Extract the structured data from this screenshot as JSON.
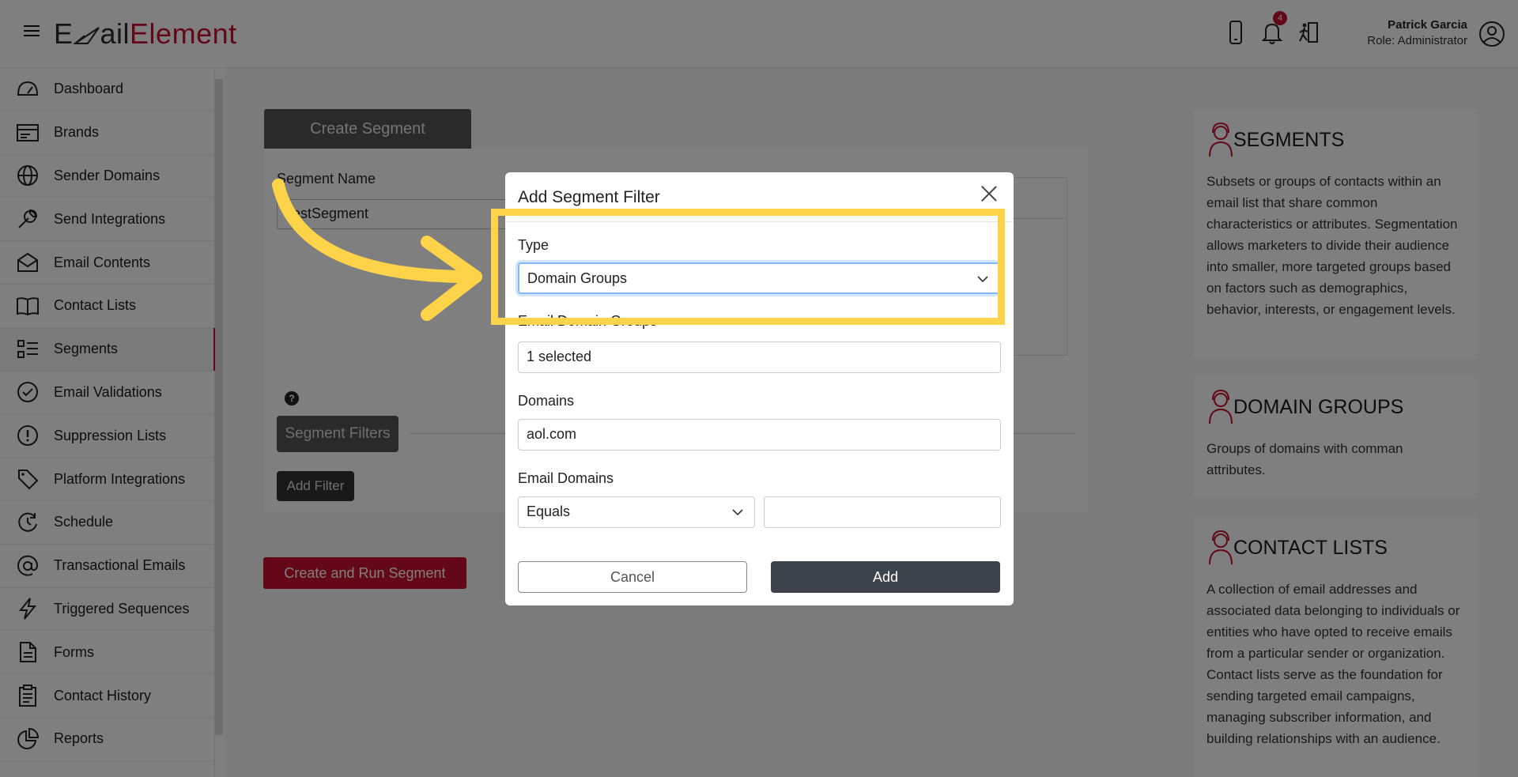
{
  "header": {
    "logo_part1": "E",
    "logo_part2": "ail",
    "logo_part3": "Element",
    "notification_count": "4",
    "user_name": "Patrick Garcia",
    "user_role": "Role: Administrator"
  },
  "sidebar": {
    "items": [
      {
        "label": "Dashboard",
        "icon": "dashboard-icon"
      },
      {
        "label": "Brands",
        "icon": "brands-icon"
      },
      {
        "label": "Sender Domains",
        "icon": "globe-icon"
      },
      {
        "label": "Send Integrations",
        "icon": "wrench-icon"
      },
      {
        "label": "Email Contents",
        "icon": "envelope-icon"
      },
      {
        "label": "Contact Lists",
        "icon": "book-icon"
      },
      {
        "label": "Segments",
        "icon": "segments-icon"
      },
      {
        "label": "Email Validations",
        "icon": "check-circle-icon"
      },
      {
        "label": "Suppression Lists",
        "icon": "exclamation-circle-icon"
      },
      {
        "label": "Platform Integrations",
        "icon": "tag-icon"
      },
      {
        "label": "Schedule",
        "icon": "schedule-icon"
      },
      {
        "label": "Transactional Emails",
        "icon": "at-icon"
      },
      {
        "label": "Triggered Sequences",
        "icon": "lightning-icon"
      },
      {
        "label": "Forms",
        "icon": "document-icon"
      },
      {
        "label": "Contact History",
        "icon": "clipboard-icon"
      },
      {
        "label": "Reports",
        "icon": "pie-chart-icon"
      }
    ]
  },
  "segment": {
    "tab_label": "Create Segment",
    "name_label": "Segment Name",
    "name_value": "TestSegment",
    "filters_label": "Segment Filters",
    "add_filter_label": "Add Filter",
    "create_run_label": "Create and Run Segment"
  },
  "modal": {
    "title": "Add Segment Filter",
    "type_label": "Type",
    "type_value": "Domain Groups",
    "email_domain_groups_label": "Email Domain Groups",
    "email_domain_groups_value": "1 selected",
    "domains_label": "Domains",
    "domains_value": "aol.com",
    "email_domains_label": "Email Domains",
    "email_domains_operator": "Equals",
    "email_domains_value": "",
    "cancel_label": "Cancel",
    "add_label": "Add"
  },
  "info_cards": [
    {
      "title": "SEGMENTS",
      "body": "Subsets or groups of contacts within an email list that share common characteristics or attributes. Segmentation allows marketers to divide their audience into smaller, more targeted groups based on factors such as demographics, behavior, interests, or engagement levels."
    },
    {
      "title": "DOMAIN GROUPS",
      "body": "Groups of domains with comman attributes."
    },
    {
      "title": "CONTACT LISTS",
      "body": "A collection of email addresses and associated data belonging to individuals or entities who have opted to receive emails from a particular sender or organization. Contact lists serve as the foundation for sending targeted email campaigns, managing subscriber information, and building relationships with an audience."
    }
  ],
  "colors": {
    "brand_red": "#c8102e",
    "highlight_yellow": "#fdd34a"
  }
}
